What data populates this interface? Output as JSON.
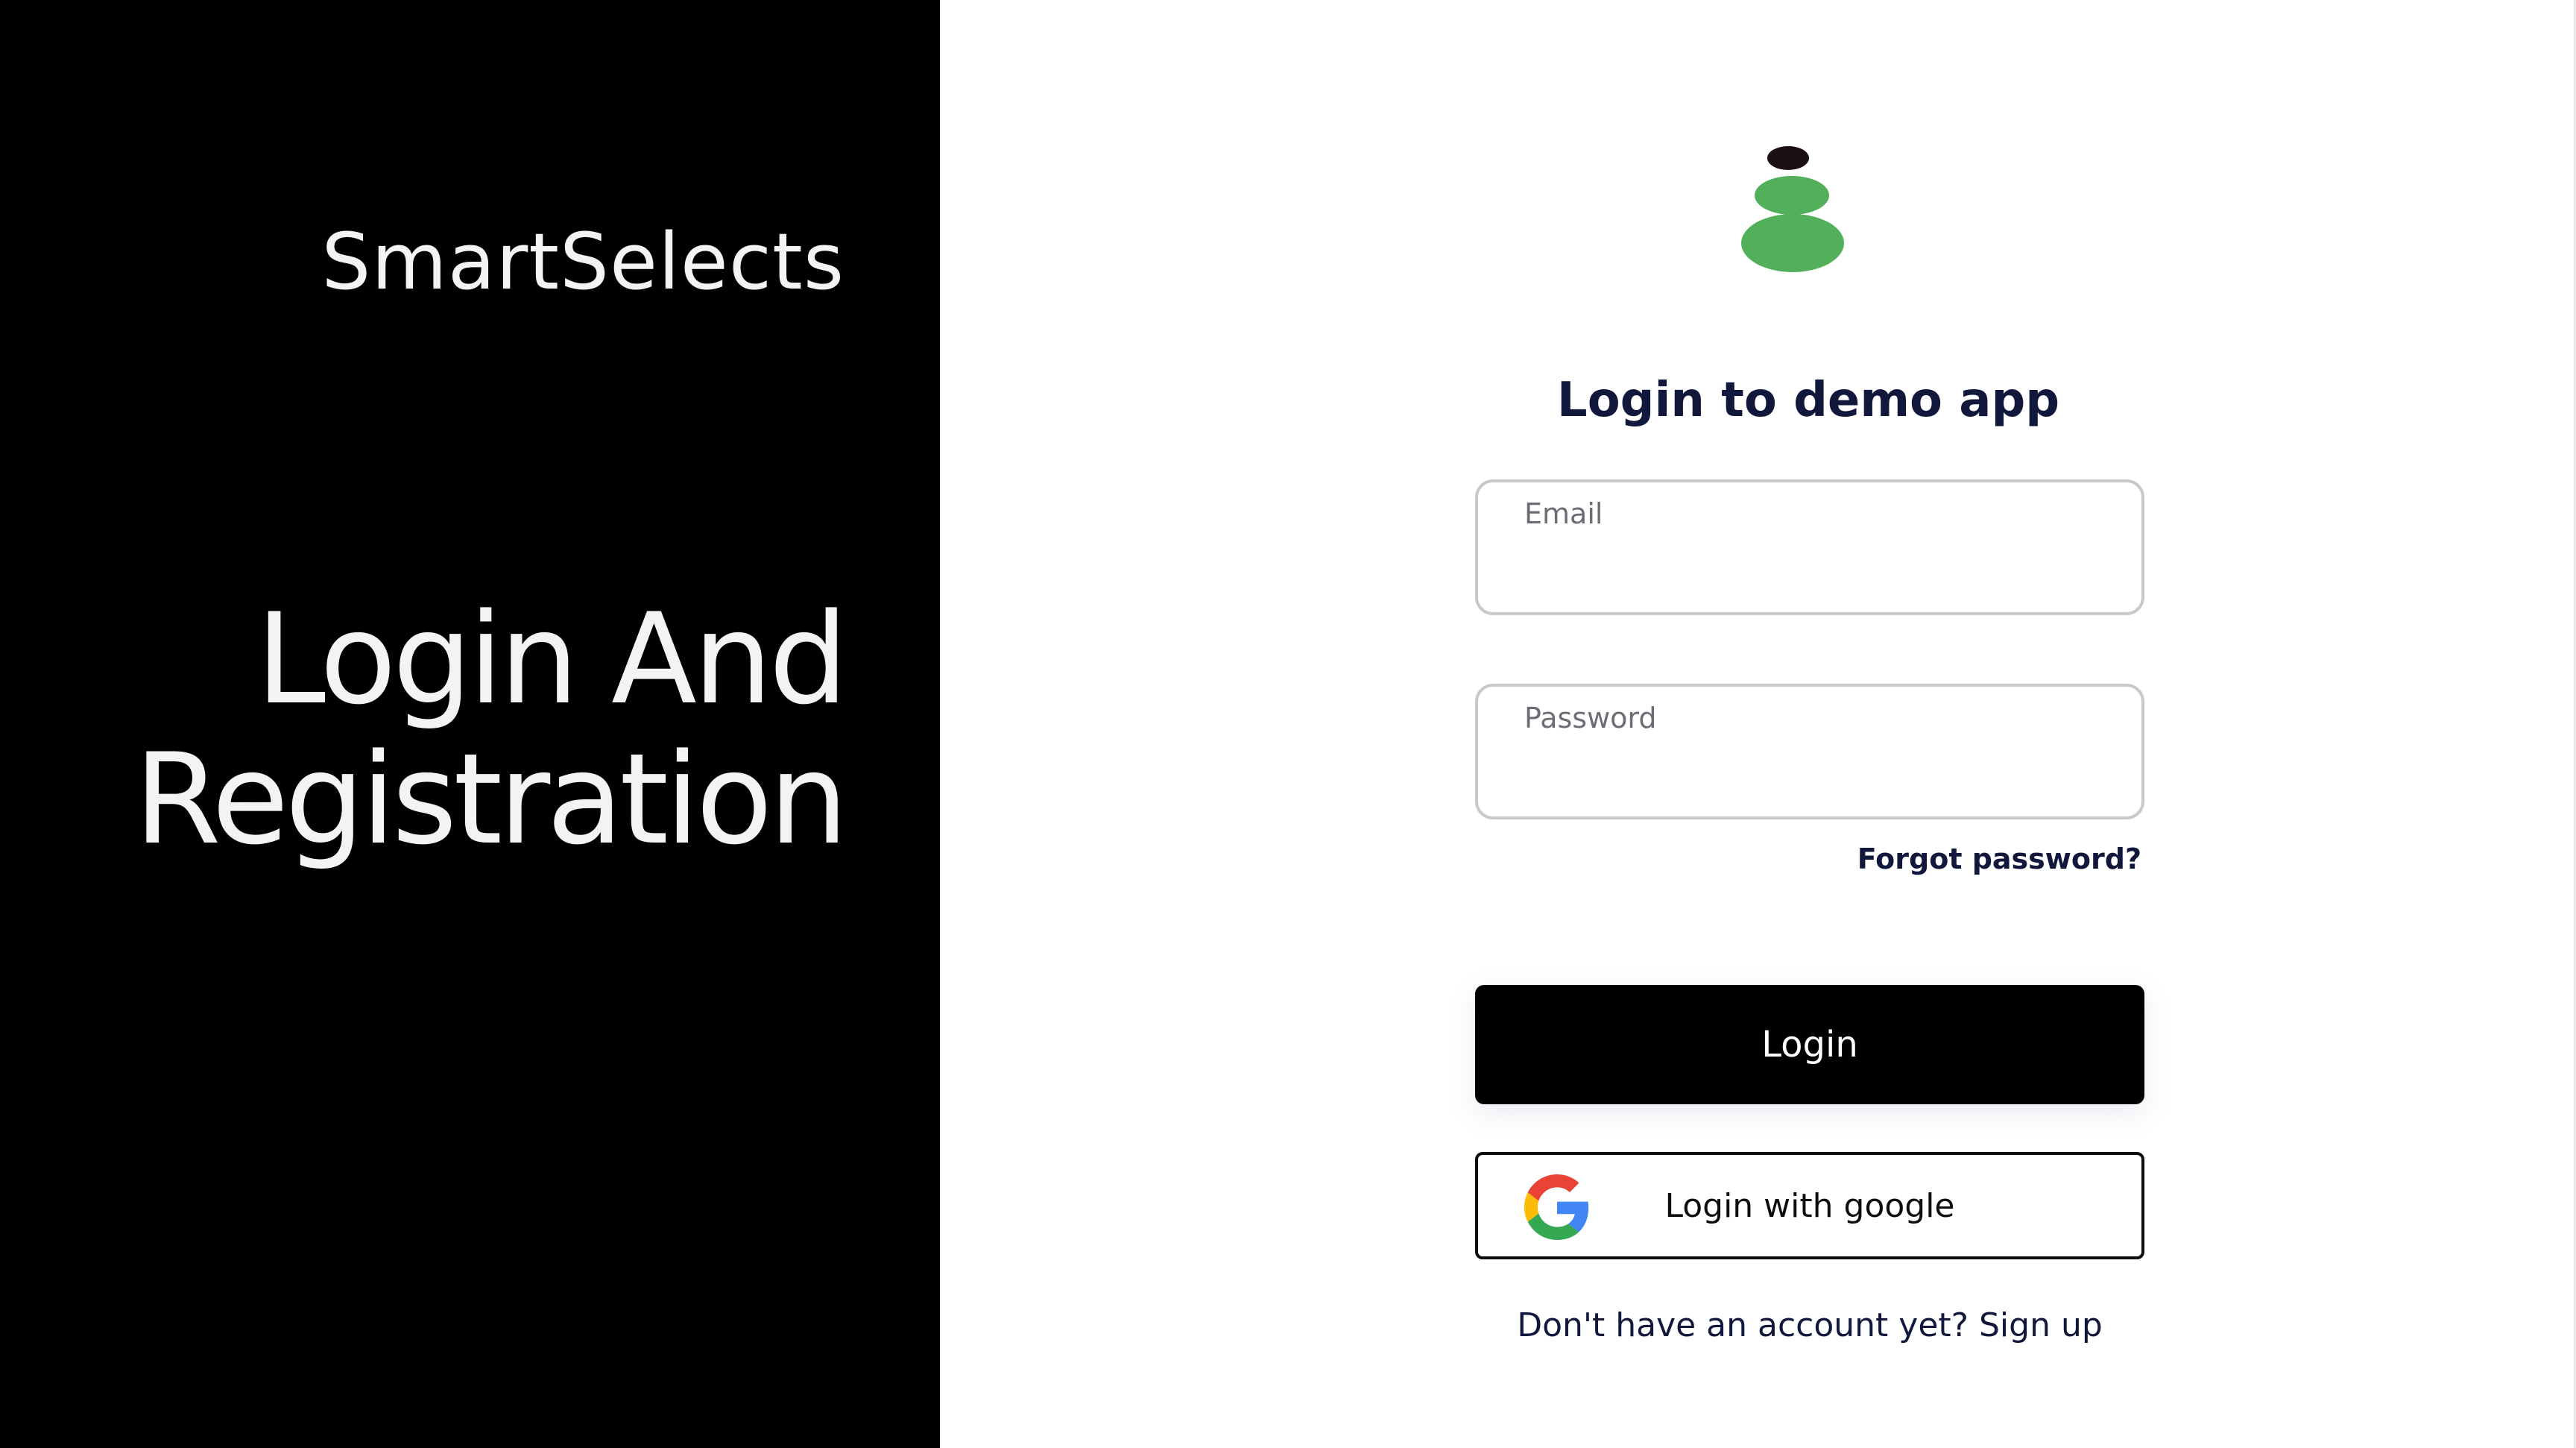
{
  "left_panel": {
    "brand": "SmartSelects",
    "headline_line1": "Login And",
    "headline_line2": "Registration"
  },
  "login_form": {
    "logo_icon": "stacked-stones-logo-icon",
    "title": "Login to demo app",
    "email": {
      "label": "Email",
      "value": ""
    },
    "password": {
      "label": "Password",
      "value": ""
    },
    "forgot_password": "Forgot password?",
    "login_button": "Login",
    "google_button": "Login with google",
    "google_icon": "google-g-icon",
    "signup_prompt": "Don't have an account yet? Sign up"
  },
  "colors": {
    "left_panel_bg": "#000000",
    "heading_navy": "#11183c",
    "logo_green": "#52b05a",
    "logo_dark": "#1a0f12",
    "button_bg": "#000000"
  }
}
